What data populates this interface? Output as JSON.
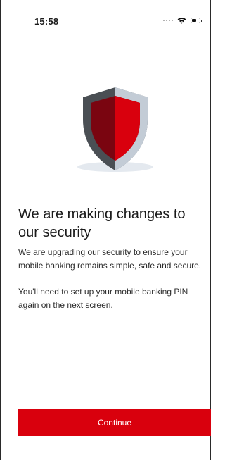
{
  "status_bar": {
    "time": "15:58",
    "icons": [
      "signal-icon",
      "wifi-icon",
      "battery-icon"
    ]
  },
  "hero": {
    "icon": "shield-icon",
    "colors": {
      "red_dark": "#7a0510",
      "red": "#d9000d",
      "grey_dark": "#4a4f54",
      "grey_light": "#c3ccd6",
      "shadow": "#e4e9ef"
    }
  },
  "content": {
    "title": "We are making changes to our security",
    "paragraph_1": "We are upgrading our security to ensure your mobile banking remains simple, safe and secure.",
    "paragraph_2": "You'll need to set up your mobile banking PIN again on the next screen."
  },
  "actions": {
    "continue_label": "Continue",
    "accent_color": "#d9000d"
  }
}
